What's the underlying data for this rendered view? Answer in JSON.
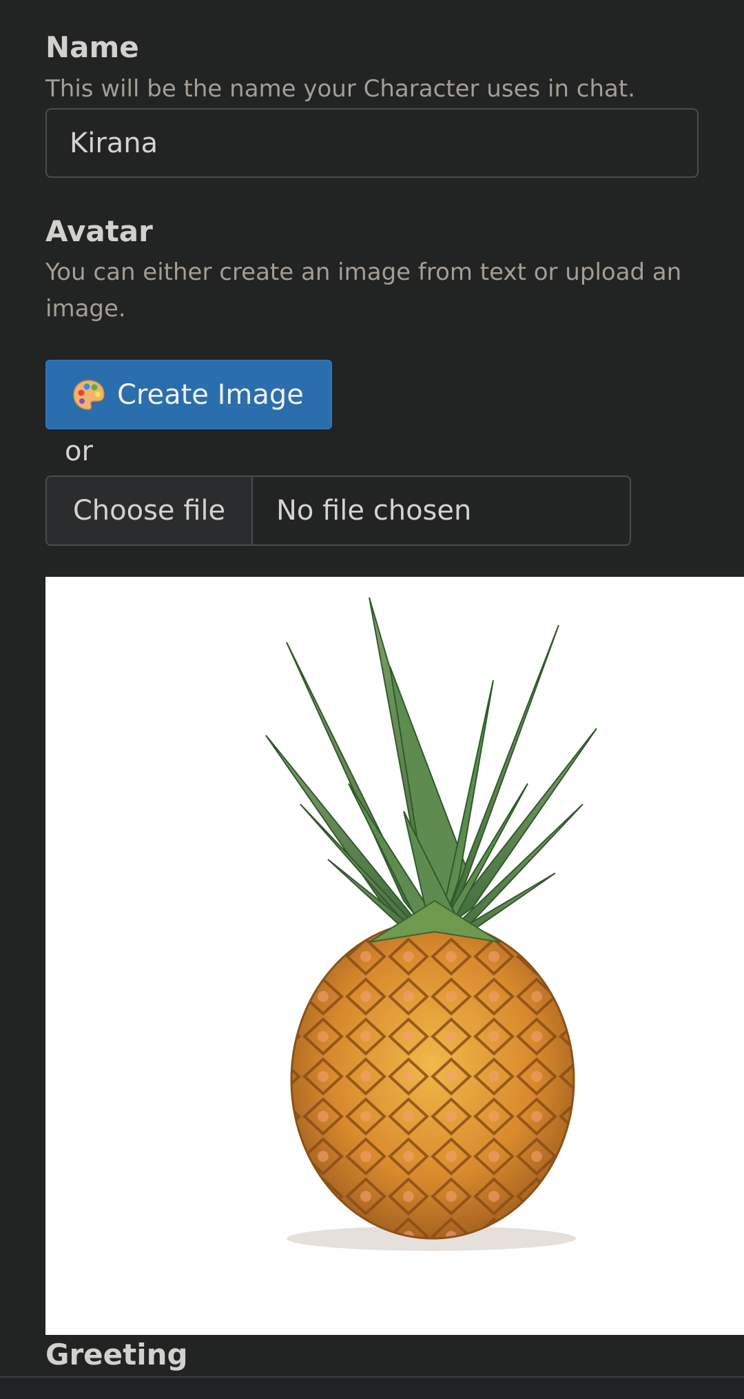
{
  "name_section": {
    "label": "Name",
    "help": "This will be the name your Character uses in chat.",
    "value": "Kirana"
  },
  "avatar_section": {
    "label": "Avatar",
    "help": "You can either create an image from text or upload an image.",
    "create_button_label": "Create Image",
    "create_button_icon": "palette-icon",
    "or_text": "or",
    "file_button_label": "Choose file",
    "file_status": "No file chosen",
    "image_subject": "pineapple"
  },
  "greeting_section": {
    "label": "Greeting"
  },
  "colors": {
    "background": "#222323",
    "accent_button": "#2a6ead",
    "text": "#d5d3cf",
    "muted_text": "#a49e95"
  }
}
